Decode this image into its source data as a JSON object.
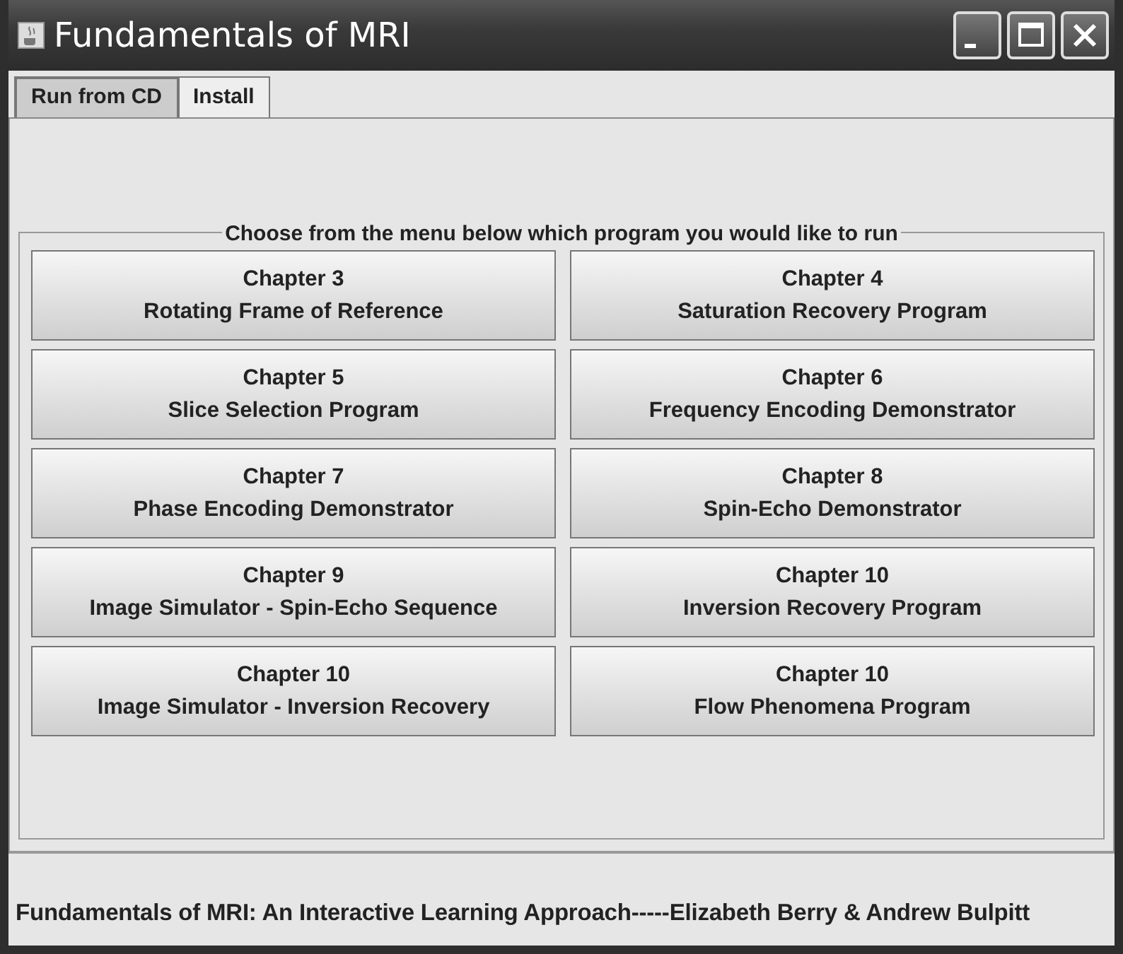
{
  "window": {
    "title": "Fundamentals of MRI"
  },
  "tabs": [
    {
      "label": "Run from CD",
      "selected": true
    },
    {
      "label": "Install",
      "selected": false
    }
  ],
  "panel": {
    "legend": "Choose from the menu below which program you would like to run",
    "buttons": [
      {
        "chapter": "Chapter 3",
        "title": "Rotating Frame of Reference"
      },
      {
        "chapter": "Chapter 4",
        "title": "Saturation Recovery Program"
      },
      {
        "chapter": "Chapter 5",
        "title": "Slice Selection Program"
      },
      {
        "chapter": "Chapter 6",
        "title": "Frequency Encoding Demonstrator"
      },
      {
        "chapter": "Chapter 7",
        "title": "Phase Encoding Demonstrator"
      },
      {
        "chapter": "Chapter 8",
        "title": "Spin-Echo Demonstrator"
      },
      {
        "chapter": "Chapter 9",
        "title": "Image Simulator - Spin-Echo Sequence"
      },
      {
        "chapter": "Chapter 10",
        "title": "Inversion Recovery Program"
      },
      {
        "chapter": "Chapter 10",
        "title": "Image Simulator - Inversion Recovery"
      },
      {
        "chapter": "Chapter 10",
        "title": "Flow Phenomena Program"
      }
    ]
  },
  "status_bar": "Fundamentals of MRI: An Interactive Learning Approach-----Elizabeth Berry & Andrew Bulpitt"
}
